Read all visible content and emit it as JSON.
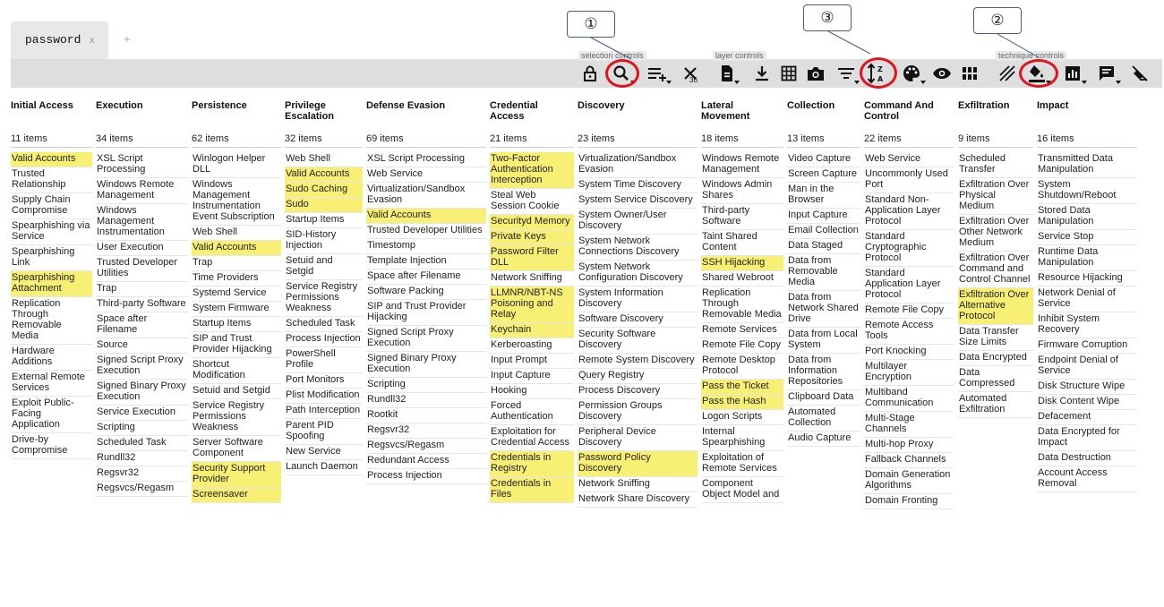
{
  "tabs": [
    {
      "title": "password",
      "close": "x"
    }
  ],
  "add_tab": "+",
  "toolbar": {
    "sections": [
      {
        "label": "selection controls"
      },
      {
        "label": "layer controls"
      },
      {
        "label": "technique controls"
      }
    ],
    "deselect_count": "36",
    "icons": [
      "lock-icon",
      "search-icon",
      "multiselect-icon",
      "deselect-icon",
      "download-layer-icon",
      "export-icon",
      "grid-icon",
      "camera-icon",
      "filter-icon",
      "sort-icon",
      "palette-icon",
      "eye-icon",
      "layout-icon",
      "hatch-icon",
      "fill-color-icon",
      "score-icon",
      "comment-icon",
      "clear-icon"
    ]
  },
  "annotations": [
    "①",
    "③",
    "②"
  ],
  "matrix": {
    "tactics": [
      {
        "name": "Initial Access",
        "count": "11 items",
        "techniques": [
          {
            "n": "Valid Accounts",
            "h": true
          },
          {
            "n": "Trusted Relationship"
          },
          {
            "n": "Supply Chain Compromise"
          },
          {
            "n": "Spearphishing via Service"
          },
          {
            "n": "Spearphishing Link"
          },
          {
            "n": "Spearphishing Attachment",
            "h": true
          },
          {
            "n": "Replication Through Removable Media"
          },
          {
            "n": "Hardware Additions"
          },
          {
            "n": "External Remote Services"
          },
          {
            "n": "Exploit Public-Facing Application"
          },
          {
            "n": "Drive-by Compromise"
          }
        ]
      },
      {
        "name": "Execution",
        "count": "34 items",
        "techniques": [
          {
            "n": "XSL Script Processing"
          },
          {
            "n": "Windows Remote Management"
          },
          {
            "n": "Windows Management Instrumentation"
          },
          {
            "n": "User Execution"
          },
          {
            "n": "Trusted Developer Utilities"
          },
          {
            "n": "Trap"
          },
          {
            "n": "Third-party Software"
          },
          {
            "n": "Space after Filename"
          },
          {
            "n": "Source"
          },
          {
            "n": "Signed Script Proxy Execution"
          },
          {
            "n": "Signed Binary Proxy Execution"
          },
          {
            "n": "Service Execution"
          },
          {
            "n": "Scripting"
          },
          {
            "n": "Scheduled Task"
          },
          {
            "n": "Rundll32"
          },
          {
            "n": "Regsvr32"
          },
          {
            "n": "Regsvcs/Regasm"
          }
        ]
      },
      {
        "name": "Persistence",
        "count": "62 items",
        "techniques": [
          {
            "n": "Winlogon Helper DLL"
          },
          {
            "n": "Windows Management Instrumentation Event Subscription"
          },
          {
            "n": "Web Shell"
          },
          {
            "n": "Valid Accounts",
            "h": true
          },
          {
            "n": "Trap"
          },
          {
            "n": "Time Providers"
          },
          {
            "n": "Systemd Service"
          },
          {
            "n": "System Firmware"
          },
          {
            "n": "Startup Items"
          },
          {
            "n": "SIP and Trust Provider Hijacking"
          },
          {
            "n": "Shortcut Modification"
          },
          {
            "n": "Setuid and Setgid"
          },
          {
            "n": "Service Registry Permissions Weakness"
          },
          {
            "n": "Server Software Component"
          },
          {
            "n": "Security Support Provider",
            "h": true
          },
          {
            "n": "Screensaver",
            "h": true
          }
        ]
      },
      {
        "name": "Privilege Escalation",
        "count": "32 items",
        "techniques": [
          {
            "n": "Web Shell"
          },
          {
            "n": "Valid Accounts",
            "h": true
          },
          {
            "n": "Sudo Caching",
            "h": true
          },
          {
            "n": "Sudo",
            "h": true
          },
          {
            "n": "Startup Items"
          },
          {
            "n": "SID-History Injection"
          },
          {
            "n": "Setuid and Setgid"
          },
          {
            "n": "Service Registry Permissions Weakness"
          },
          {
            "n": "Scheduled Task"
          },
          {
            "n": "Process Injection"
          },
          {
            "n": "PowerShell Profile"
          },
          {
            "n": "Port Monitors"
          },
          {
            "n": "Plist Modification"
          },
          {
            "n": "Path Interception"
          },
          {
            "n": "Parent PID Spoofing"
          },
          {
            "n": "New Service"
          },
          {
            "n": "Launch Daemon"
          }
        ]
      },
      {
        "name": "Defense Evasion",
        "count": "69 items",
        "techniques": [
          {
            "n": "XSL Script Processing"
          },
          {
            "n": "Web Service"
          },
          {
            "n": "Virtualization/Sandbox Evasion"
          },
          {
            "n": "Valid Accounts",
            "h": true
          },
          {
            "n": "Trusted Developer Utilities"
          },
          {
            "n": "Timestomp"
          },
          {
            "n": "Template Injection"
          },
          {
            "n": "Space after Filename"
          },
          {
            "n": "Software Packing"
          },
          {
            "n": "SIP and Trust Provider Hijacking"
          },
          {
            "n": "Signed Script Proxy Execution"
          },
          {
            "n": "Signed Binary Proxy Execution"
          },
          {
            "n": "Scripting"
          },
          {
            "n": "Rundll32"
          },
          {
            "n": "Rootkit"
          },
          {
            "n": "Regsvr32"
          },
          {
            "n": "Regsvcs/Regasm"
          },
          {
            "n": "Redundant Access"
          },
          {
            "n": "Process Injection"
          }
        ]
      },
      {
        "name": "Credential Access",
        "count": "21 items",
        "techniques": [
          {
            "n": "Two-Factor Authentication Interception",
            "h": true
          },
          {
            "n": "Steal Web Session Cookie"
          },
          {
            "n": "Securityd Memory",
            "h": true
          },
          {
            "n": "Private Keys",
            "h": true
          },
          {
            "n": "Password Filter DLL",
            "h": true
          },
          {
            "n": "Network Sniffing"
          },
          {
            "n": "LLMNR/NBT-NS Poisoning and Relay",
            "h": true
          },
          {
            "n": "Keychain",
            "h": true
          },
          {
            "n": "Kerberoasting"
          },
          {
            "n": "Input Prompt"
          },
          {
            "n": "Input Capture"
          },
          {
            "n": "Hooking"
          },
          {
            "n": "Forced Authentication"
          },
          {
            "n": "Exploitation for Credential Access"
          },
          {
            "n": "Credentials in Registry",
            "h": true
          },
          {
            "n": "Credentials in Files",
            "h": true
          }
        ]
      },
      {
        "name": "Discovery",
        "count": "23 items",
        "techniques": [
          {
            "n": "Virtualization/Sandbox Evasion"
          },
          {
            "n": "System Time Discovery"
          },
          {
            "n": "System Service Discovery"
          },
          {
            "n": "System Owner/User Discovery"
          },
          {
            "n": "System Network Connections Discovery"
          },
          {
            "n": "System Network Configuration Discovery"
          },
          {
            "n": "System Information Discovery"
          },
          {
            "n": "Software Discovery"
          },
          {
            "n": "Security Software Discovery"
          },
          {
            "n": "Remote System Discovery"
          },
          {
            "n": "Query Registry"
          },
          {
            "n": "Process Discovery"
          },
          {
            "n": "Permission Groups Discovery"
          },
          {
            "n": "Peripheral Device Discovery"
          },
          {
            "n": "Password Policy Discovery",
            "h": true
          },
          {
            "n": "Network Sniffing"
          },
          {
            "n": "Network Share Discovery"
          }
        ]
      },
      {
        "name": "Lateral Movement",
        "count": "18 items",
        "techniques": [
          {
            "n": "Windows Remote Management"
          },
          {
            "n": "Windows Admin Shares"
          },
          {
            "n": "Third-party Software"
          },
          {
            "n": "Taint Shared Content"
          },
          {
            "n": "SSH Hijacking",
            "h": true
          },
          {
            "n": "Shared Webroot"
          },
          {
            "n": "Replication Through Removable Media"
          },
          {
            "n": "Remote Services"
          },
          {
            "n": "Remote File Copy"
          },
          {
            "n": "Remote Desktop Protocol"
          },
          {
            "n": "Pass the Ticket",
            "h": true
          },
          {
            "n": "Pass the Hash",
            "h": true
          },
          {
            "n": "Logon Scripts"
          },
          {
            "n": "Internal Spearphishing"
          },
          {
            "n": "Exploitation of Remote Services"
          },
          {
            "n": "Component Object Model and"
          }
        ]
      },
      {
        "name": "Collection",
        "count": "13 items",
        "techniques": [
          {
            "n": "Video Capture"
          },
          {
            "n": "Screen Capture"
          },
          {
            "n": "Man in the Browser"
          },
          {
            "n": "Input Capture"
          },
          {
            "n": "Email Collection"
          },
          {
            "n": "Data Staged"
          },
          {
            "n": "Data from Removable Media"
          },
          {
            "n": "Data from Network Shared Drive"
          },
          {
            "n": "Data from Local System"
          },
          {
            "n": "Data from Information Repositories"
          },
          {
            "n": "Clipboard Data"
          },
          {
            "n": "Automated Collection"
          },
          {
            "n": "Audio Capture"
          }
        ]
      },
      {
        "name": "Command And Control",
        "count": "22 items",
        "techniques": [
          {
            "n": "Web Service"
          },
          {
            "n": "Uncommonly Used Port"
          },
          {
            "n": "Standard Non-Application Layer Protocol"
          },
          {
            "n": "Standard Cryptographic Protocol"
          },
          {
            "n": "Standard Application Layer Protocol"
          },
          {
            "n": "Remote File Copy"
          },
          {
            "n": "Remote Access Tools"
          },
          {
            "n": "Port Knocking"
          },
          {
            "n": "Multilayer Encryption"
          },
          {
            "n": "Multiband Communication"
          },
          {
            "n": "Multi-Stage Channels"
          },
          {
            "n": "Multi-hop Proxy"
          },
          {
            "n": "Fallback Channels"
          },
          {
            "n": "Domain Generation Algorithms"
          },
          {
            "n": "Domain Fronting"
          }
        ]
      },
      {
        "name": "Exfiltration",
        "count": "9 items",
        "techniques": [
          {
            "n": "Scheduled Transfer"
          },
          {
            "n": "Exfiltration Over Physical Medium"
          },
          {
            "n": "Exfiltration Over Other Network Medium"
          },
          {
            "n": "Exfiltration Over Command and Control Channel"
          },
          {
            "n": "Exfiltration Over Alternative Protocol",
            "h": true
          },
          {
            "n": "Data Transfer Size Limits"
          },
          {
            "n": "Data Encrypted"
          },
          {
            "n": "Data Compressed"
          },
          {
            "n": "Automated Exfiltration"
          }
        ]
      },
      {
        "name": "Impact",
        "count": "16 items",
        "techniques": [
          {
            "n": "Transmitted Data Manipulation"
          },
          {
            "n": "System Shutdown/Reboot"
          },
          {
            "n": "Stored Data Manipulation"
          },
          {
            "n": "Service Stop"
          },
          {
            "n": "Runtime Data Manipulation"
          },
          {
            "n": "Resource Hijacking"
          },
          {
            "n": "Network Denial of Service"
          },
          {
            "n": "Inhibit System Recovery"
          },
          {
            "n": "Firmware Corruption"
          },
          {
            "n": "Endpoint Denial of Service"
          },
          {
            "n": "Disk Structure Wipe"
          },
          {
            "n": "Disk Content Wipe"
          },
          {
            "n": "Defacement"
          },
          {
            "n": "Data Encrypted for Impact"
          },
          {
            "n": "Data Destruction"
          },
          {
            "n": "Account Access Removal"
          }
        ]
      }
    ]
  }
}
